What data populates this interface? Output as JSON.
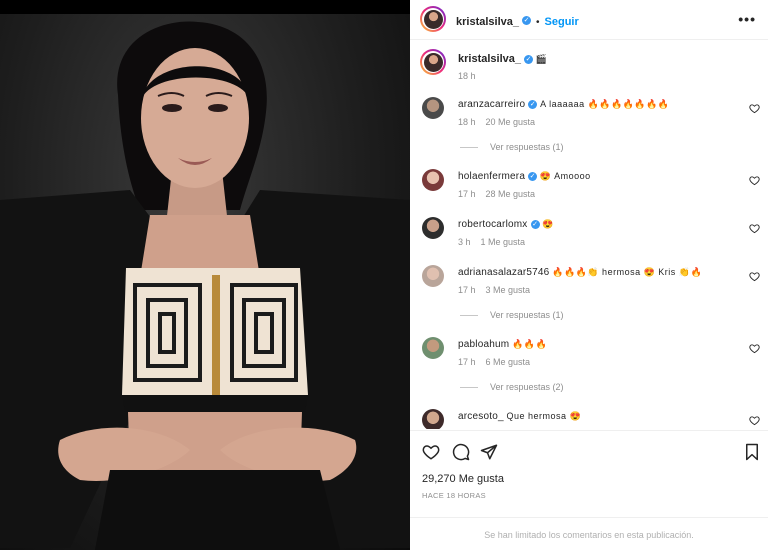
{
  "post": {
    "author": "kristalsilva_",
    "follow_label": "Seguir",
    "dot": "•",
    "more": "•••",
    "caption_emoji": "🎬",
    "caption_time": "18 h",
    "likes": "29,270 Me gusta",
    "posted_ago": "HACE 18 HORAS",
    "comments_limited": "Se han limitado los comentarios en esta publicación.",
    "photo_description": "woman in black blazer and patterned zip crop top against dark background"
  },
  "comments": [
    {
      "user": "aranzacarreiro",
      "verified": true,
      "text": "A laaaaaa 🔥🔥🔥🔥🔥🔥🔥",
      "time": "18 h",
      "likes": "20 Me gusta",
      "replies": "Ver respuestas (1)"
    },
    {
      "user": "holaenfermera",
      "verified": true,
      "text": "😍 Amoooo",
      "time": "17 h",
      "likes": "28 Me gusta",
      "replies": ""
    },
    {
      "user": "robertocarlomx",
      "verified": true,
      "text": "😍",
      "time": "3 h",
      "likes": "1 Me gusta",
      "replies": ""
    },
    {
      "user": "adrianasalazar5746",
      "verified": false,
      "text": "🔥🔥🔥👏 hermosa 😍 Kris 👏🔥",
      "time": "17 h",
      "likes": "3 Me gusta",
      "replies": "Ver respuestas (1)"
    },
    {
      "user": "pabloahum",
      "verified": false,
      "text": "🔥🔥🔥",
      "time": "17 h",
      "likes": "6 Me gusta",
      "replies": "Ver respuestas (2)"
    },
    {
      "user": "arcesoto_",
      "verified": false,
      "text": "Que hermosa 😍",
      "time": "",
      "likes": "",
      "replies": ""
    }
  ],
  "colors": {
    "accent": "#0095f6",
    "verified": "#3897f0",
    "muted": "#8e8e8e"
  }
}
